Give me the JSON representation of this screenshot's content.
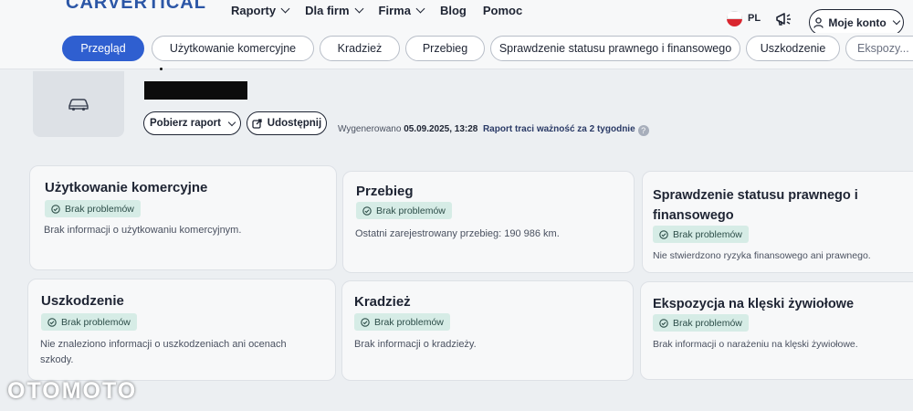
{
  "nav": {
    "logo": "CARVERTICAL",
    "items": [
      "Raporty",
      "Dla firm",
      "Firma",
      "Blog",
      "Pomoc"
    ],
    "lang": "PL",
    "account": "Moje konto"
  },
  "tabs": [
    "Przegląd",
    "Użytkowanie komercyjne",
    "Kradzież",
    "Przebieg",
    "Sprawdzenie statusu prawnego i finansowego",
    "Uszkodzenie",
    "Ekspozy..."
  ],
  "report": {
    "download_label": "Pobierz raport",
    "share_label": "Udostępnij",
    "generated_prefix": "Wygenerowano",
    "generated_date": "05.09.2025, 13:28",
    "validity": "Raport traci ważność za 2 tygodnie"
  },
  "cards": [
    {
      "title": "Użytkowanie komercyjne",
      "badge": "Brak problemów",
      "desc": "Brak informacji o użytkowaniu komercyjnym."
    },
    {
      "title": "Przebieg",
      "badge": "Brak problemów",
      "desc": "Ostatni zarejestrowany przebieg: 190 986 km."
    },
    {
      "title": "Sprawdzenie statusu prawnego i finansowego",
      "badge": "Brak problemów",
      "desc": "Nie stwierdzono ryzyka finansowego ani prawnego."
    },
    {
      "title": "Uszkodzenie",
      "badge": "Brak problemów",
      "desc": "Nie znaleziono informacji o uszkodzeniach ani ocenach szkody."
    },
    {
      "title": "Kradzież",
      "badge": "Brak problemów",
      "desc": "Brak informacji o kradzieży."
    },
    {
      "title": "Ekspozycja na klęski żywiołowe",
      "badge": "Brak problemów",
      "desc": "Brak informacji o narażeniu na klęski żywiołowe."
    }
  ],
  "watermark": "OTOMOTO",
  "colors": {
    "accent": "#2f5fd0",
    "badge_bg": "#d6ece6",
    "logo": "#2b56a6"
  }
}
